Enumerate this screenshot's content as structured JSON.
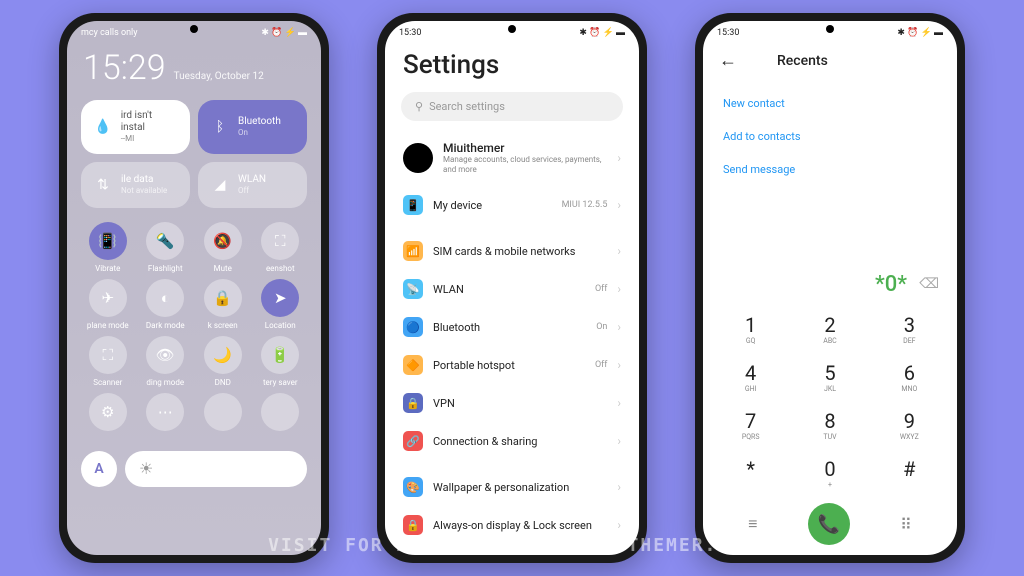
{
  "watermark": "VISIT FOR MORE THEMES - MIUITHEMER.COM",
  "phone1": {
    "status_left": "mcy calls only",
    "time": "15:29",
    "date": "Tuesday, October 12",
    "tiles": {
      "humidity": {
        "label": "ird isn't instal",
        "sub": "--MI"
      },
      "bluetooth": {
        "label": "Bluetooth",
        "sub": "On"
      },
      "data": {
        "label": "ile data",
        "sub": "Not available"
      },
      "wlan": {
        "label": "WLAN",
        "sub": "Off"
      }
    },
    "toggles": [
      "Vibrate",
      "Flashlight",
      "Mute",
      "eenshot",
      "plane mode",
      "Dark mode",
      "k screen",
      "Location",
      "Scanner",
      "ding mode",
      "DND",
      "tery saver",
      "",
      "",
      "",
      ""
    ],
    "auto": "A"
  },
  "phone2": {
    "time": "15:30",
    "title": "Settings",
    "search_placeholder": "Search settings",
    "account": {
      "name": "Miuithemer",
      "sub": "Manage accounts, cloud services, payments, and more"
    },
    "items": [
      {
        "icon": "📱",
        "color": "#4fc3f7",
        "label": "My device",
        "val": "MIUI 12.5.5"
      },
      {
        "icon": "📶",
        "color": "#ffb74d",
        "label": "SIM cards & mobile networks",
        "val": ""
      },
      {
        "icon": "📡",
        "color": "#4fc3f7",
        "label": "WLAN",
        "val": "Off"
      },
      {
        "icon": "🔵",
        "color": "#42a5f5",
        "label": "Bluetooth",
        "val": "On"
      },
      {
        "icon": "🔶",
        "color": "#ffb74d",
        "label": "Portable hotspot",
        "val": "Off"
      },
      {
        "icon": "🔒",
        "color": "#5c6bc0",
        "label": "VPN",
        "val": ""
      },
      {
        "icon": "🔗",
        "color": "#ef5350",
        "label": "Connection & sharing",
        "val": ""
      },
      {
        "icon": "🎨",
        "color": "#42a5f5",
        "label": "Wallpaper & personalization",
        "val": ""
      },
      {
        "icon": "🔒",
        "color": "#ef5350",
        "label": "Always-on display & Lock screen",
        "val": ""
      }
    ]
  },
  "phone3": {
    "time": "15:30",
    "title": "Recents",
    "links": [
      "New contact",
      "Add to contacts",
      "Send message"
    ],
    "display": "*0*",
    "keys": [
      {
        "n": "1",
        "l": "GQ"
      },
      {
        "n": "2",
        "l": "ABC"
      },
      {
        "n": "3",
        "l": "DEF"
      },
      {
        "n": "4",
        "l": "GHI"
      },
      {
        "n": "5",
        "l": "JKL"
      },
      {
        "n": "6",
        "l": "MNO"
      },
      {
        "n": "7",
        "l": "PQRS"
      },
      {
        "n": "8",
        "l": "TUV"
      },
      {
        "n": "9",
        "l": "WXYZ"
      },
      {
        "n": "*",
        "l": ""
      },
      {
        "n": "0",
        "l": "+"
      },
      {
        "n": "#",
        "l": ""
      }
    ]
  }
}
